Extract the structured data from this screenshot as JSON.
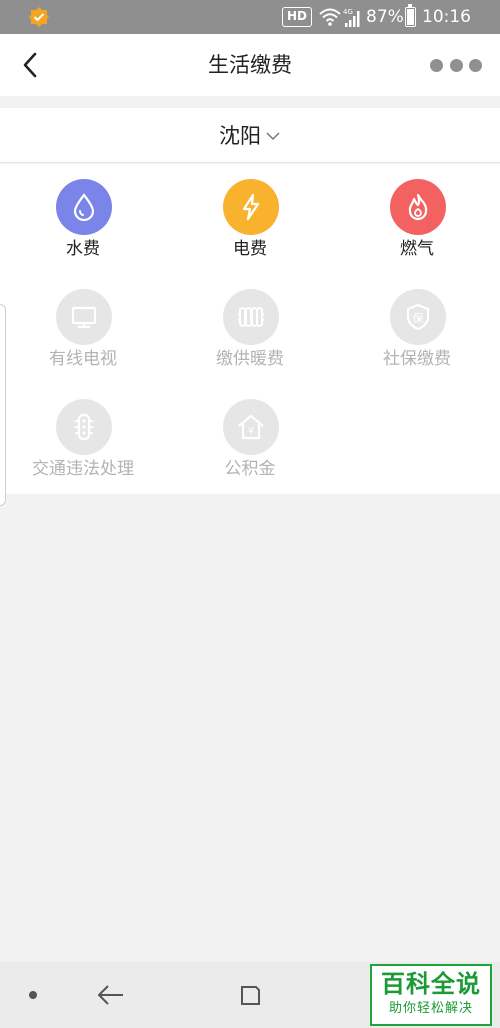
{
  "status_bar": {
    "hd": "HD",
    "battery_percent": "87%",
    "battery_level": 0.87,
    "time": "10:16",
    "icons": [
      "app-notification-icon",
      "wifi-icon",
      "signal-icon",
      "battery-icon"
    ]
  },
  "nav": {
    "title": "生活缴费",
    "icons": [
      "back-arrow-icon",
      "more-options-icon"
    ]
  },
  "city": {
    "name": "沈阳",
    "icon": "chevron-down-icon"
  },
  "services": {
    "water": {
      "label": "水费",
      "icon": "water-drop-icon",
      "color": "#7b84e8",
      "enabled": true
    },
    "electric": {
      "label": "电费",
      "icon": "lightning-icon",
      "color": "#f8b22e",
      "enabled": true
    },
    "gas": {
      "label": "燃气",
      "icon": "flame-icon",
      "color": "#f36161",
      "enabled": true
    },
    "cable_tv": {
      "label": "有线电视",
      "icon": "monitor-icon",
      "color": "#e6e6e6",
      "enabled": false
    },
    "heating": {
      "label": "缴供暖费",
      "icon": "radiator-icon",
      "color": "#e6e6e6",
      "enabled": false
    },
    "social_security": {
      "label": "社保缴费",
      "icon": "shield-icon",
      "shield_text": "保",
      "color": "#e6e6e6",
      "enabled": false
    },
    "traffic": {
      "label": "交通违法处理",
      "icon": "traffic-light-icon",
      "color": "#e6e6e6",
      "enabled": false
    },
    "housing_fund": {
      "label": "公积金",
      "icon": "house-yen-icon",
      "house_text": "¥",
      "color": "#e6e6e6",
      "enabled": false
    }
  },
  "bottom_nav": {
    "icons": [
      "dot-icon",
      "back-icon",
      "recent-apps-icon"
    ]
  },
  "watermark": {
    "main": "百科全说",
    "sub": "助你轻松解决"
  }
}
